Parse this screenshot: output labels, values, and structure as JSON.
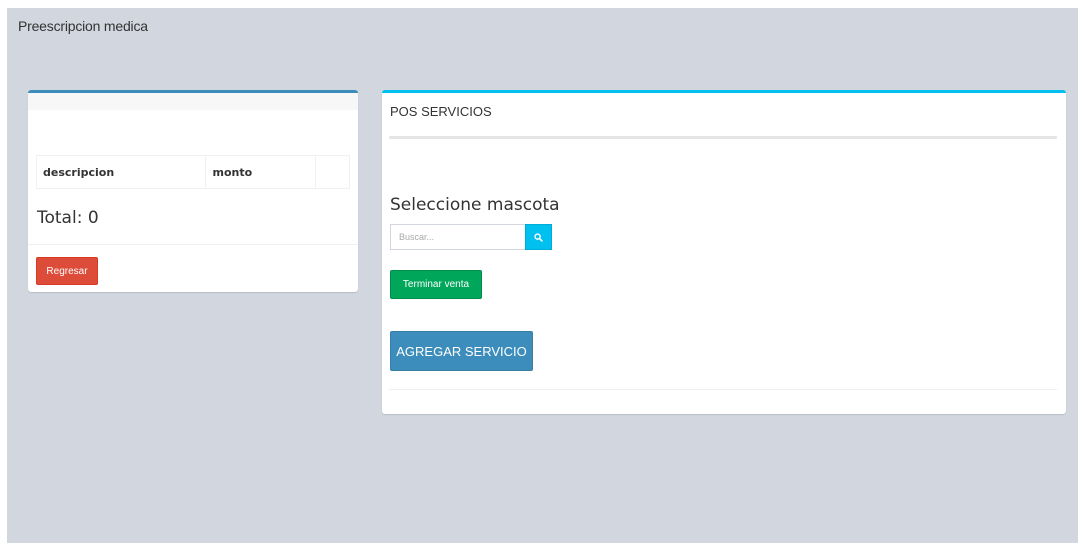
{
  "page": {
    "title": "Preescripcion medica"
  },
  "left_box": {
    "table": {
      "headers": [
        "descripcion",
        "monto",
        ""
      ]
    },
    "total_text": "Total: 0",
    "back_button": "Regresar"
  },
  "right_box": {
    "title": "POS SERVICIOS",
    "select_heading": "Seleccione mascota",
    "search": {
      "placeholder": "Buscar...",
      "icon": "search-icon"
    },
    "finish_button": "Terminar venta",
    "add_service_button": "AGREGAR SERVICIO"
  },
  "colors": {
    "background": "#d2d6de",
    "primary": "#3c8dbc",
    "info": "#00c0ef",
    "success": "#00a65a",
    "danger": "#dd4b39"
  }
}
